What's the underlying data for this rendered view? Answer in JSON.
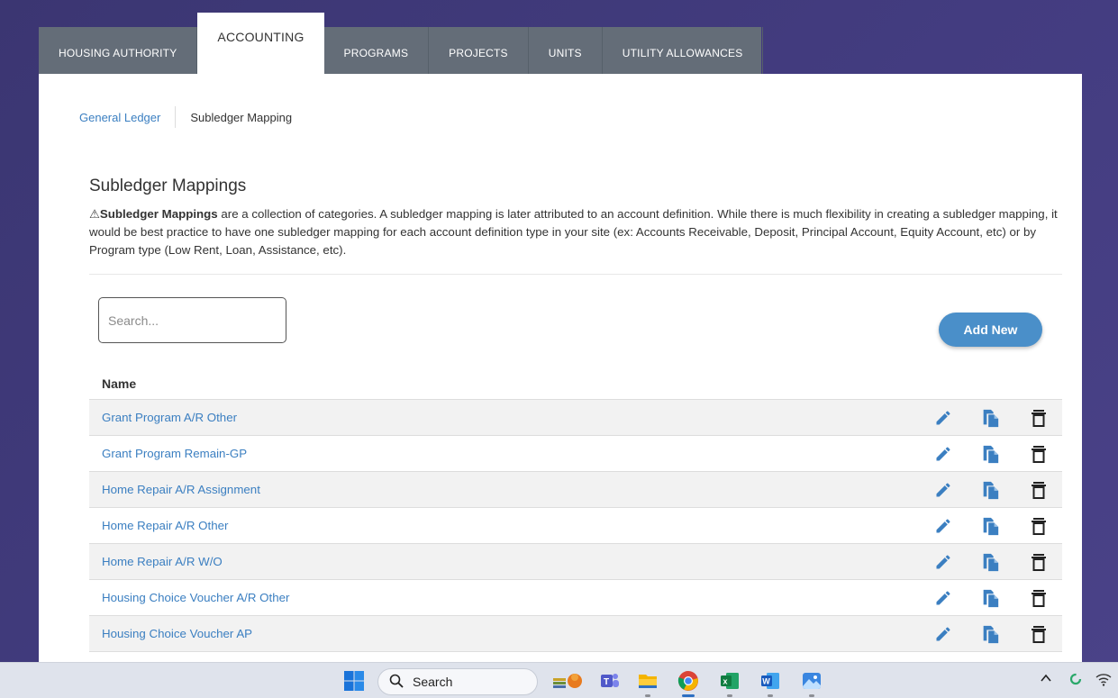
{
  "tabs": [
    {
      "label": "HOUSING AUTHORITY",
      "active": false
    },
    {
      "label": "ACCOUNTING",
      "active": true
    },
    {
      "label": "PROGRAMS",
      "active": false
    },
    {
      "label": "PROJECTS",
      "active": false
    },
    {
      "label": "UNITS",
      "active": false
    },
    {
      "label": "UTILITY ALLOWANCES",
      "active": false
    }
  ],
  "subnav": {
    "link": "General Ledger",
    "current": "Subledger Mapping"
  },
  "section": {
    "title": "Subledger Mappings",
    "warn_symbol": "⚠",
    "desc_bold": "Subledger Mappings",
    "desc_text": " are a collection of categories. A subledger mapping is later attributed to an account definition. While there is much flexibility in creating a subledger mapping, it would be best practice to have one subledger mapping for each account definition type in your site (ex: Accounts Receivable, Deposit, Principal Account, Equity Account, etc) or by Program type (Low Rent, Loan, Assistance, etc)."
  },
  "search": {
    "placeholder": "Search...",
    "value": ""
  },
  "add_button": "Add New",
  "table": {
    "header": "Name",
    "rows": [
      "Grant Program A/R Other",
      "Grant Program Remain-GP",
      "Home Repair A/R Assignment",
      "Home Repair A/R Other",
      "Home Repair A/R W/O",
      "Housing Choice Voucher A/R Other",
      "Housing Choice Voucher AP"
    ],
    "row_actions": [
      "pencil-icon",
      "copy-icon",
      "trash-icon"
    ]
  },
  "taskbar": {
    "search_label": "Search",
    "icons": [
      "windows-start-icon",
      "search-icon",
      "widgets-icon",
      "teams-icon",
      "file-explorer-icon",
      "chrome-icon",
      "excel-icon",
      "word-icon",
      "photos-icon"
    ],
    "tray": [
      "chevron-up-icon",
      "sync-icon",
      "wifi-icon"
    ]
  },
  "colors": {
    "accent": "#3b7fc1",
    "button": "#4a8fc9",
    "tabbar": "#646d78",
    "background": "#3b3672"
  }
}
